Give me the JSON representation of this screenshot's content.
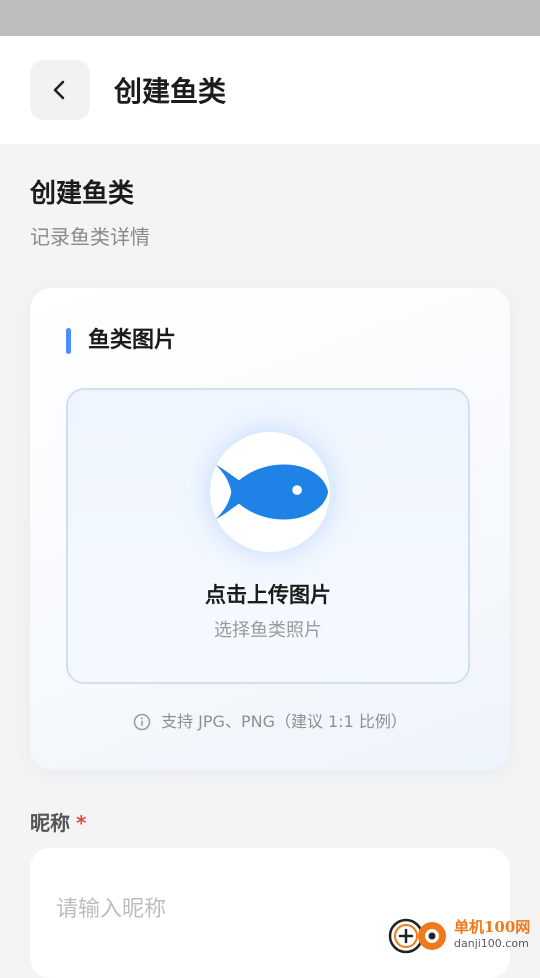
{
  "nav": {
    "title": "创建鱼类"
  },
  "header": {
    "title": "创建鱼类",
    "subtitle": "记录鱼类详情"
  },
  "image_card": {
    "title": "鱼类图片",
    "upload_label": "点击上传图片",
    "upload_hint": "选择鱼类照片",
    "support_text": "支持 JPG、PNG（建议 1:1 比例）"
  },
  "nickname_field": {
    "label": "昵称",
    "required_mark": "*",
    "placeholder": "请输入昵称",
    "value": ""
  },
  "watermark": {
    "main": "单机100网",
    "sub": "danji100.com"
  },
  "icons": {
    "back": "chevron-left-icon",
    "fish": "fish-icon",
    "info": "info-icon"
  },
  "colors": {
    "accent": "#4d8dff",
    "fish": "#1f82e6",
    "required": "#e5473a",
    "nav_bg": "#ffffff",
    "page_bg": "#f4f4f4"
  }
}
